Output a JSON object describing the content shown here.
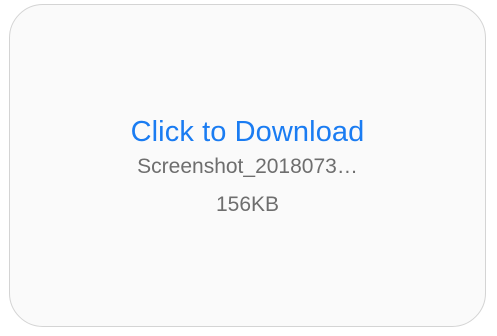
{
  "download": {
    "link_label": "Click to Download",
    "file_name": "Screenshot_2018073…",
    "file_size": "156KB"
  },
  "colors": {
    "link": "#1a7cf2",
    "secondary_text": "#6e6e6e",
    "card_background": "#fafafa",
    "card_border": "#d4d4d4"
  }
}
